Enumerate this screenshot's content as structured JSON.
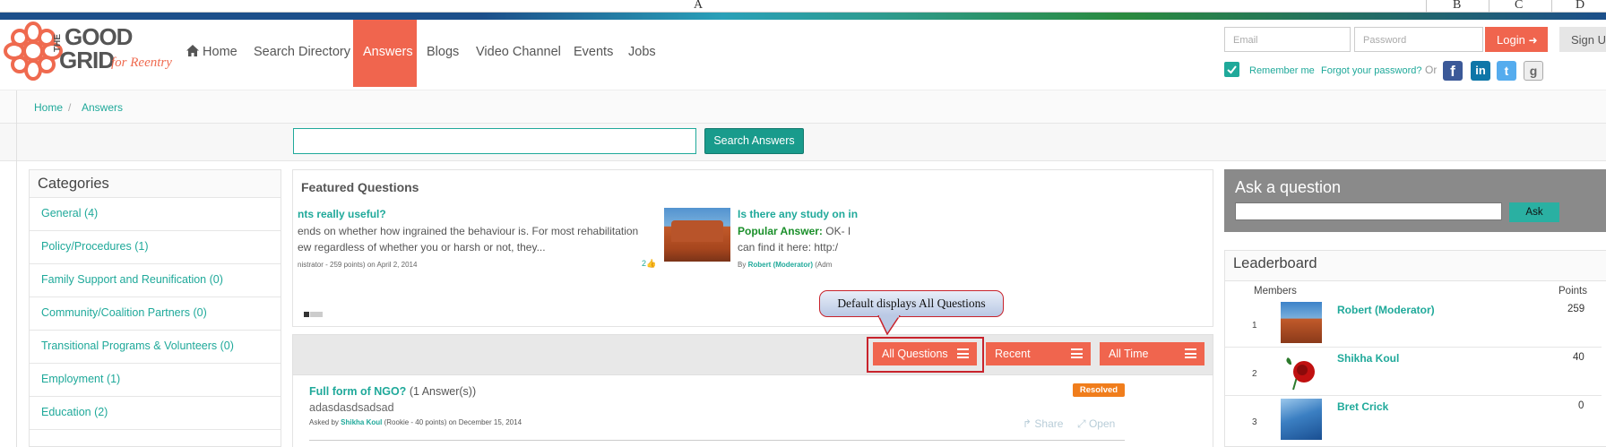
{
  "spreadsheet": {
    "columns": [
      "A",
      "B",
      "C",
      "D"
    ]
  },
  "logo": {
    "line1": "THE",
    "line2": "GOOD",
    "line3": "GRID",
    "tagline": "for Reentry"
  },
  "nav": {
    "home": "Home",
    "search_directory": "Search Directory",
    "answers": "Answers",
    "blogs": "Blogs",
    "video": "Video Channel",
    "events": "Events",
    "jobs": "Jobs"
  },
  "login": {
    "email_ph": "Email",
    "password_ph": "Password",
    "login_label": "Login",
    "signup_label": "Sign Up",
    "remember": "Remember me",
    "forgot": "Forgot your password?",
    "or": "Or"
  },
  "breadcrumb": {
    "home": "Home",
    "sep": "/",
    "current": "Answers"
  },
  "search": {
    "button": "Search Answers",
    "value": ""
  },
  "categories": {
    "title": "Categories",
    "items": [
      "General (4)",
      "Policy/Procedures (1)",
      "Family Support and Reunification (0)",
      "Community/Coalition Partners (0)",
      "Transitional Programs & Volunteers (0)",
      "Employment (1)",
      "Education (2)"
    ]
  },
  "featured": {
    "title": "Featured Questions",
    "card1": {
      "title": "nts really useful?",
      "line1": "ends on whether how ingrained the behaviour is. For most rehabilitation",
      "line2": "ew regardless of whether you or harsh or not, they...",
      "meta": "nistrator - 259 points)  on April 2, 2014",
      "likes": "2"
    },
    "card2": {
      "title": "Is there any study on in",
      "popular_label": "Popular Answer:",
      "popular_text": " OK- I",
      "line2": "can find it here: http:/",
      "by": "By ",
      "author": "Robert (Moderator)",
      "extra": "(Adm"
    }
  },
  "callout": "Default displays All Questions",
  "filters": {
    "all_questions": "All Questions",
    "recent": "Recent",
    "all_time": "All Time"
  },
  "question": {
    "title": "Full form of NGO?",
    "answers": "(1 Answer(s))",
    "body": "adasdasdsadsad",
    "asked_by": "Asked by ",
    "author": "Shikha Koul",
    "rank": "(Rookie - 40 points)",
    "date": " on December 15, 2014",
    "status": "Resolved",
    "share": "Share",
    "open": "Open"
  },
  "ask": {
    "title": "Ask a question",
    "button": "Ask",
    "value": ""
  },
  "leaderboard": {
    "title": "Leaderboard",
    "col_members": "Members",
    "col_points": "Points",
    "rows": [
      {
        "rank": "1",
        "name": "Robert (Moderator)",
        "points": "259"
      },
      {
        "rank": "2",
        "name": "Shikha Koul",
        "points": "40"
      },
      {
        "rank": "3",
        "name": "Bret Crick",
        "points": "0"
      }
    ]
  },
  "colors": {
    "accent": "#f0654e",
    "teal": "#1fa99a",
    "button_teal": "#199b8c",
    "resolved": "#f07d1c"
  }
}
